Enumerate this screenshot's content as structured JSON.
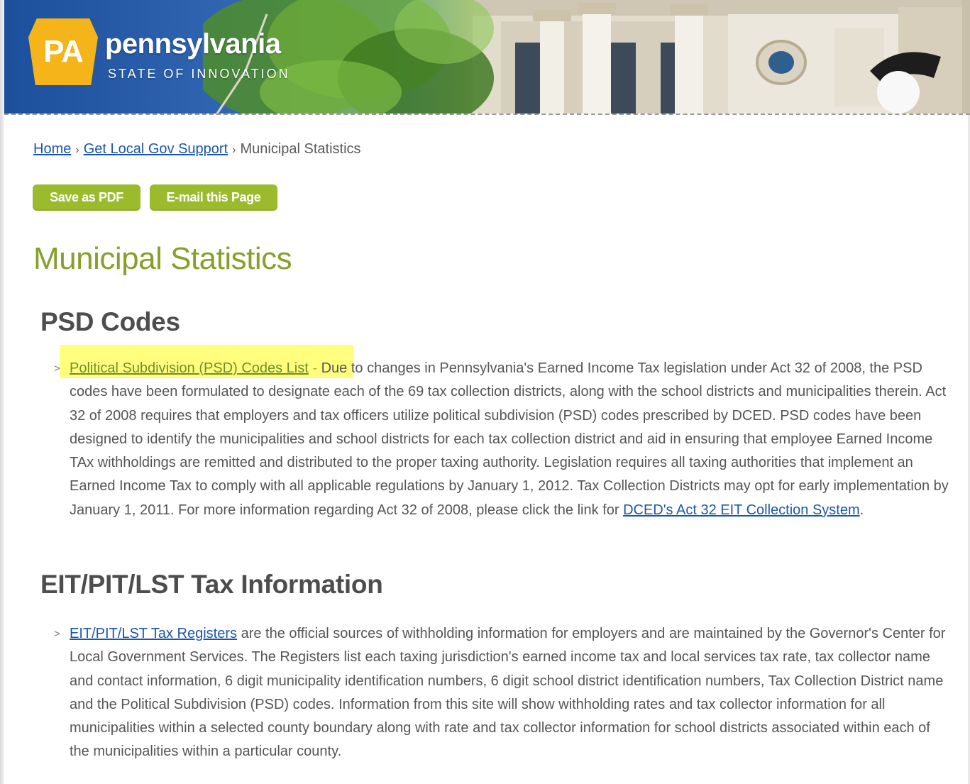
{
  "banner": {
    "logo_letters": "PA",
    "brand_name": "pennsylvania",
    "tagline": "STATE OF INNOVATION"
  },
  "breadcrumb": {
    "items": [
      {
        "label": "Home"
      },
      {
        "label": "Get Local Gov Support"
      },
      {
        "label": "Municipal Statistics"
      }
    ],
    "separator": "›"
  },
  "actions": {
    "save_pdf": "Save as PDF",
    "email_page": "E-mail this Page"
  },
  "page_title": "Municipal Statistics",
  "sections": [
    {
      "heading": "PSD Codes",
      "bullet": ">",
      "link": "Political Subdivision (PSD) Codes List",
      "dash": " - ",
      "text": "Due to changes in Pennsylvania's Earned Income Tax legislation under Act 32 of 2008, the PSD codes have been formulated to designate each of the 69 tax collection districts, along with the school districts and municipalities therein.  Act 32 of 2008 requires that employers and tax officers utilize political subdivision (PSD) codes prescribed by DCED.  PSD codes have been designed to identify the municipalities and school districts for each tax collection district and aid in ensuring that employee Earned Income TAx withholdings are remitted and distributed to the proper taxing authority.  Legislation requires all taxing authorities that implement an Earned Income Tax to comply with all applicable regulations by January 1, 2012.  Tax Collection Districts may opt for early implementation by January 1, 2011.  For more information regarding Act 32 of 2008, please click the link for ",
      "trailing_link": "DCED's Act 32 EIT Collection System",
      "trailing_text": "."
    },
    {
      "heading": "EIT/PIT/LST Tax Information",
      "bullet": ">",
      "link": "EIT/PIT/LST Tax Registers",
      "text": " are the official sources of withholding information for employers and are maintained by the Governor's Center for Local Government Services.  The Registers list each taxing jurisdiction's earned income tax and local services tax rate, tax collector name and contact information, 6 digit municipality identification numbers, 6 digit school district identification numbers, Tax Collection District name and the Political Subdivision (PSD) codes.  Information from this site will show withholding rates and tax collector information for all municipalities within a selected county boundary along with rate and tax collector information for school districts associated within each of the municipalities within a particular county."
    }
  ],
  "colors": {
    "accent_green": "#9bbb2c",
    "title_green": "#86a02a",
    "link_blue": "#1b57a8",
    "keystone_gold": "#f4b41a",
    "highlight_yellow": "#ffff66"
  }
}
